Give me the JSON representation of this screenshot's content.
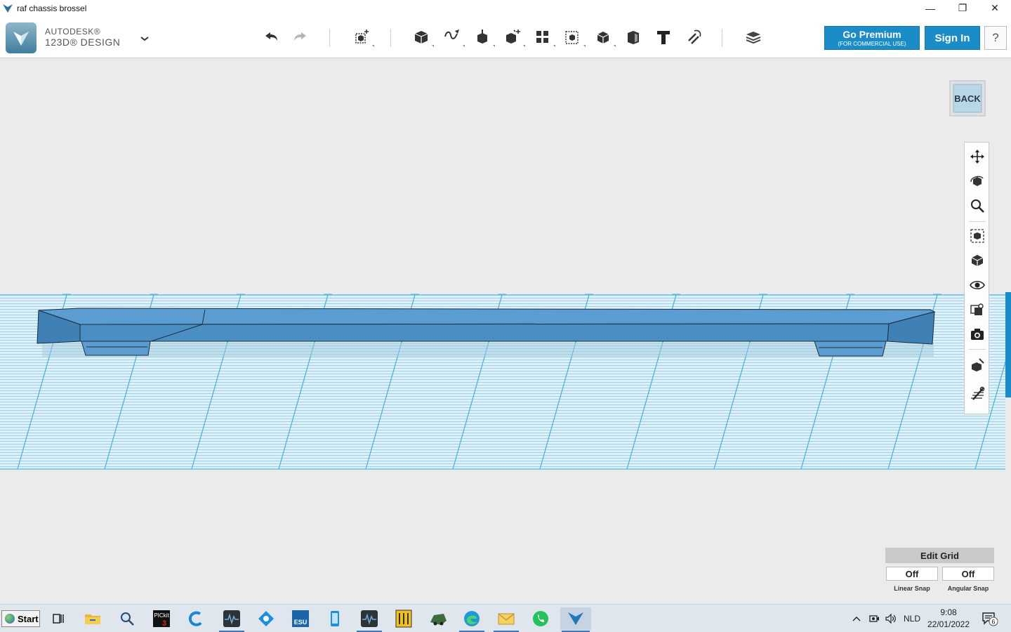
{
  "window": {
    "title": "raf chassis brossel",
    "controls": {
      "minimize": "—",
      "restore": "❐",
      "close": "✕"
    }
  },
  "toolbar": {
    "brand_line1": "AUTODESK®",
    "brand_line2": "123D® DESIGN",
    "premium_label": "Go Premium",
    "premium_sub": "(FOR COMMERCIAL USE)",
    "signin_label": "Sign In",
    "help_label": "?",
    "tools": [
      {
        "name": "undo-icon"
      },
      {
        "name": "redo-icon"
      },
      {
        "name": "transform-icon"
      },
      {
        "name": "primitives-icon"
      },
      {
        "name": "sketch-icon"
      },
      {
        "name": "construct-icon"
      },
      {
        "name": "modify-icon"
      },
      {
        "name": "pattern-icon"
      },
      {
        "name": "group-icon"
      },
      {
        "name": "combine-icon"
      },
      {
        "name": "measure-icon"
      },
      {
        "name": "text-icon"
      },
      {
        "name": "snap-icon"
      },
      {
        "name": "material-icon"
      }
    ]
  },
  "viewport": {
    "viewcube_label": "BACK",
    "accent_color": "#1a8dc8",
    "grid_color": "#3aa6d6",
    "model_color": "#4a8fc3"
  },
  "grid_panel": {
    "edit_grid": "Edit Grid",
    "linear_value": "Off",
    "angular_value": "Off",
    "linear_label": "Linear Snap",
    "angular_label": "Angular Snap"
  },
  "taskbar": {
    "start_label": "Start",
    "language": "NLD",
    "time": "9:08",
    "date": "22/01/2022",
    "notification_count": "6"
  }
}
